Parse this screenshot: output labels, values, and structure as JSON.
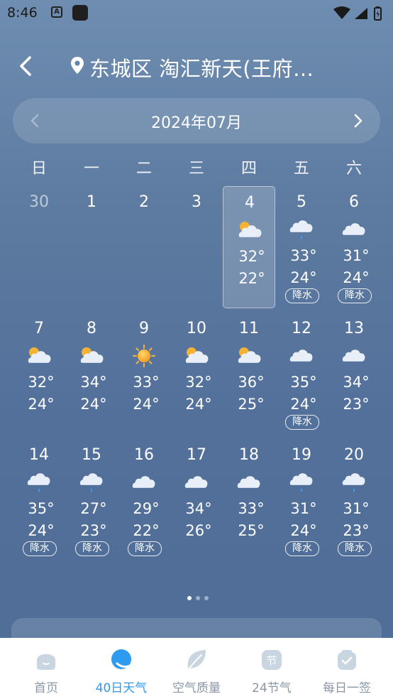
{
  "status": {
    "time": "8:46",
    "a_icon_letter": "A"
  },
  "header": {
    "location": "东城区 淘汇新天(王府…"
  },
  "calendar": {
    "month_label": "2024年07月",
    "weekdays": [
      "日",
      "一",
      "二",
      "三",
      "四",
      "五",
      "六"
    ],
    "rows": [
      [
        {
          "day": "30",
          "dim": true
        },
        {
          "day": "1",
          "dim": false
        },
        {
          "day": "2",
          "dim": false
        },
        {
          "day": "3",
          "dim": false
        },
        {
          "day": "4",
          "icon": "partly-cloudy-icon",
          "high": "32°",
          "low": "22°",
          "selected": true
        },
        {
          "day": "5",
          "icon": "rain-icon",
          "high": "33°",
          "low": "24°",
          "rain": "降水"
        },
        {
          "day": "6",
          "icon": "cloudy-icon",
          "high": "31°",
          "low": "24°",
          "rain": "降水"
        }
      ],
      [
        {
          "day": "7",
          "icon": "partly-cloudy-icon",
          "high": "32°",
          "low": "24°"
        },
        {
          "day": "8",
          "icon": "partly-cloudy-icon",
          "high": "34°",
          "low": "24°"
        },
        {
          "day": "9",
          "icon": "sunny-icon",
          "high": "33°",
          "low": "24°"
        },
        {
          "day": "10",
          "icon": "partly-cloudy-icon",
          "high": "32°",
          "low": "24°"
        },
        {
          "day": "11",
          "icon": "partly-cloudy-icon",
          "high": "36°",
          "low": "25°"
        },
        {
          "day": "12",
          "icon": "cloudy-icon",
          "high": "35°",
          "low": "24°",
          "rain": "降水"
        },
        {
          "day": "13",
          "icon": "cloudy-icon",
          "high": "34°",
          "low": "23°"
        }
      ],
      [
        {
          "day": "14",
          "icon": "rain-icon",
          "high": "35°",
          "low": "24°",
          "rain": "降水"
        },
        {
          "day": "15",
          "icon": "rain-icon",
          "high": "27°",
          "low": "23°",
          "rain": "降水"
        },
        {
          "day": "16",
          "icon": "cloudy-icon",
          "high": "29°",
          "low": "22°",
          "rain": "降水"
        },
        {
          "day": "17",
          "icon": "cloudy-icon",
          "high": "34°",
          "low": "26°"
        },
        {
          "day": "18",
          "icon": "cloudy-icon",
          "high": "33°",
          "low": "25°"
        },
        {
          "day": "19",
          "icon": "rain-icon",
          "high": "31°",
          "low": "24°",
          "rain": "降水"
        },
        {
          "day": "20",
          "icon": "rain-icon",
          "high": "31°",
          "low": "23°",
          "rain": "降水"
        }
      ]
    ]
  },
  "pager": {
    "pages": 3,
    "active": 0
  },
  "tabbar": {
    "tabs": [
      {
        "label": "首页",
        "icon": "home-icon",
        "active": false
      },
      {
        "label": "40日天气",
        "icon": "forecast-icon",
        "active": true
      },
      {
        "label": "空气质量",
        "icon": "leaf-icon",
        "active": false
      },
      {
        "label": "24节气",
        "icon": "solar-term-icon",
        "icon_text": "节",
        "active": false
      },
      {
        "label": "每日一签",
        "icon": "daily-sign-icon",
        "active": false
      }
    ]
  },
  "colors": {
    "accent": "#2e9af0",
    "tab_inactive": "#8a97a6",
    "tab_icon_inactive": "#c9d6e2"
  }
}
